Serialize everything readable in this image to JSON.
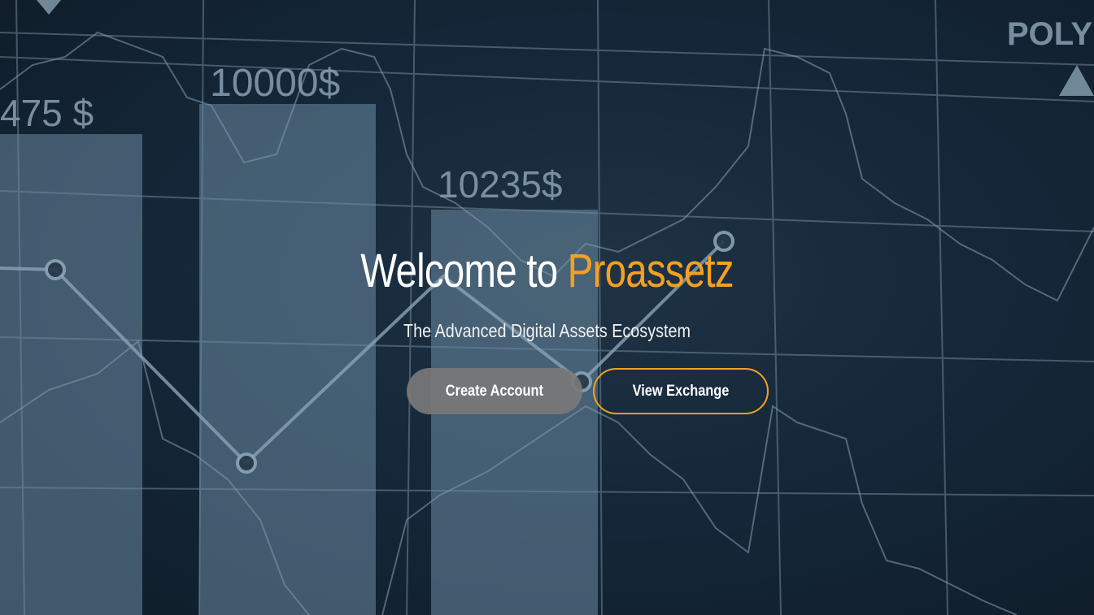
{
  "hero": {
    "title_prefix": "Welcome to ",
    "title_brand": "Proassetz",
    "subtitle": "The Advanced Digital Assets Ecosystem",
    "buttons": {
      "create_account": "Create Account",
      "view_exchange": "View Exchange"
    },
    "background_labels": {
      "price_left": "475 $",
      "price_mid": "10000$",
      "price_center": "10235$",
      "ticker": "POLY"
    }
  },
  "colors": {
    "accent": "#f5a020",
    "background": "#15283a",
    "button_grey": "#787878"
  }
}
